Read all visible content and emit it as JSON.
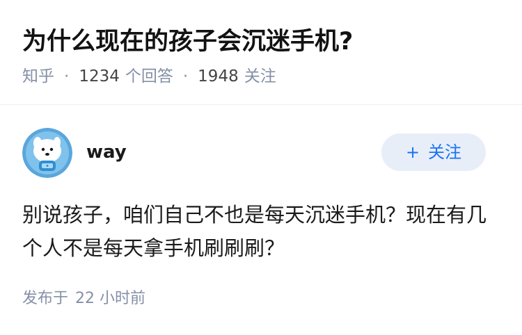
{
  "question": {
    "title": "为什么现在的孩子会沉迷手机?",
    "source": "知乎",
    "separator": "·",
    "answer_count": "1234",
    "answer_unit": "个回答",
    "follow_count": "1948",
    "follow_unit": "关注"
  },
  "answer": {
    "author": {
      "name": "way",
      "avatar_icon": "cartoon-dog-astronaut-avatar"
    },
    "follow_button": {
      "plus": "+",
      "label": "关注"
    },
    "content": "别说孩子，咱们自己不也是每天沉迷手机？现在有几个人不是每天拿手机刷刷刷？",
    "published_prefix": "发布于",
    "published_time": "22 小时前"
  },
  "colors": {
    "meta_gray": "#8590a6",
    "accent_blue": "#1772f6",
    "button_bg": "#e8eef8",
    "avatar_bg": "#6fb6e6"
  }
}
